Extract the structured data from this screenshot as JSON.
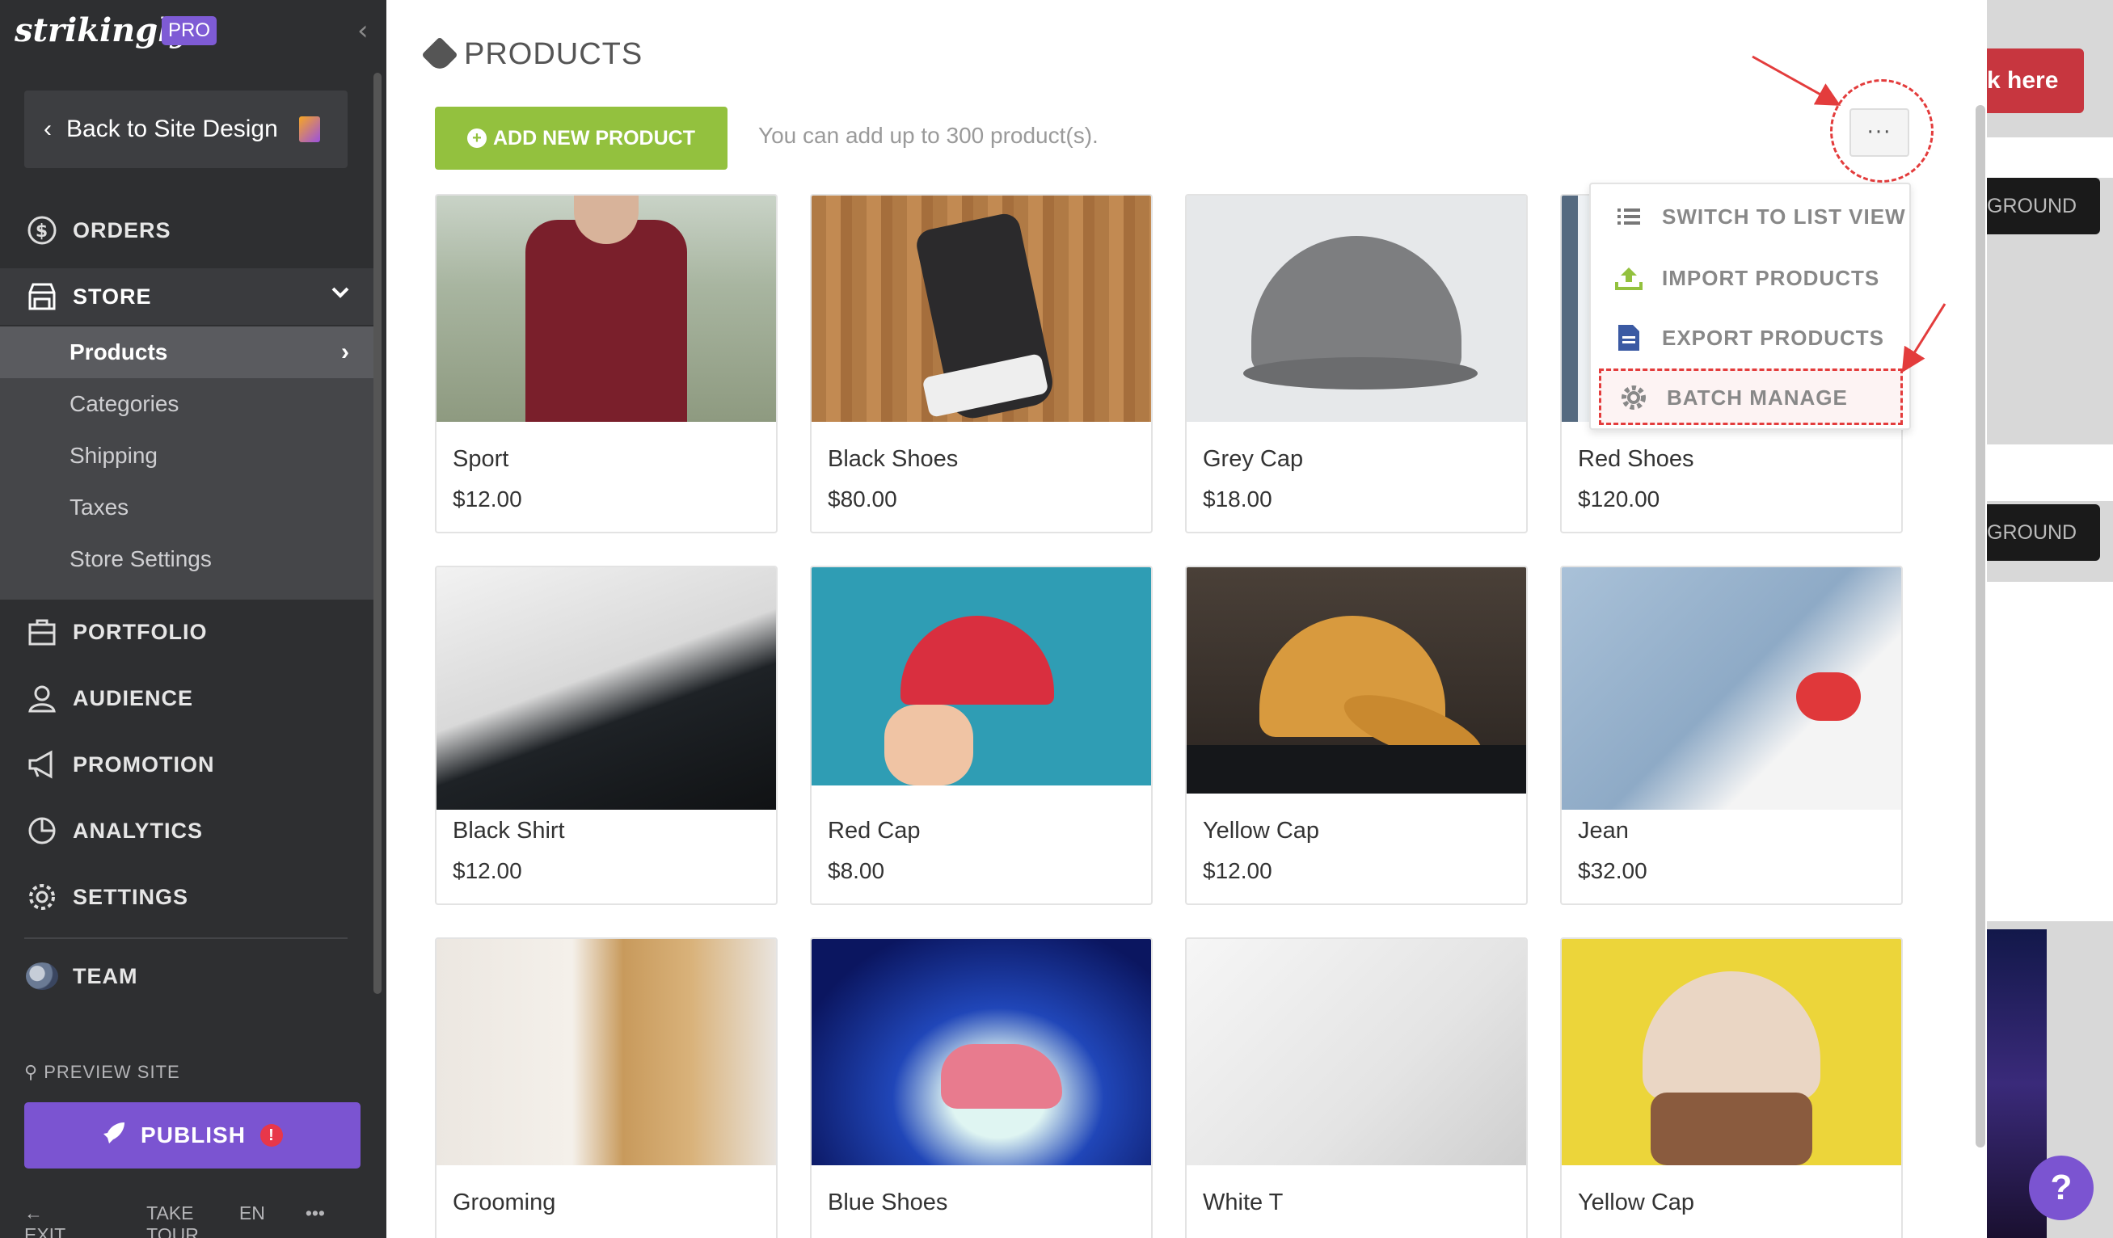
{
  "sidebar": {
    "logo": "strikingly",
    "pro_badge": "PRO",
    "back_label": "Back to Site Design",
    "nav": {
      "orders": "ORDERS",
      "store": "STORE",
      "portfolio": "PORTFOLIO",
      "audience": "AUDIENCE",
      "promotion": "PROMOTION",
      "analytics": "ANALYTICS",
      "settings": "SETTINGS",
      "team": "TEAM"
    },
    "store_sub": [
      "Products",
      "Categories",
      "Shipping",
      "Taxes",
      "Store Settings"
    ],
    "preview": "PREVIEW SITE",
    "publish": "PUBLISH",
    "publish_warning": "!",
    "footer": {
      "exit": "EXIT",
      "tour": "TAKE TOUR",
      "lang": "EN",
      "more": "•••"
    }
  },
  "main": {
    "title": "PRODUCTS",
    "add_button": "ADD NEW PRODUCT",
    "limit_text": "You can add up to 300 product(s).",
    "more_button": "···",
    "dropdown": [
      "SWITCH TO LIST VIEW",
      "IMPORT PRODUCTS",
      "EXPORT PRODUCTS",
      "BATCH MANAGE"
    ],
    "products": [
      {
        "name": "Sport",
        "price": "$12.00"
      },
      {
        "name": "Black Shoes",
        "price": "$80.00"
      },
      {
        "name": "Grey Cap",
        "price": "$18.00"
      },
      {
        "name": "Red Shoes",
        "price": "$120.00"
      },
      {
        "name": "Black Shirt",
        "price": "$12.00"
      },
      {
        "name": "Red Cap",
        "price": "$8.00"
      },
      {
        "name": "Yellow Cap",
        "price": "$12.00"
      },
      {
        "name": "Jean",
        "price": "$32.00"
      },
      {
        "name": "Grooming",
        "price": ""
      },
      {
        "name": "Blue Shoes",
        "price": ""
      },
      {
        "name": "White T",
        "price": ""
      },
      {
        "name": "Yellow Cap",
        "price": ""
      }
    ]
  },
  "background": {
    "click_here": "k here",
    "ground_1": "GROUND",
    "ground_2": "GROUND",
    "help": "?"
  },
  "colors": {
    "accent_purple": "#7b54d1",
    "add_green": "#93c13e",
    "annotation_red": "#e33c3c"
  }
}
